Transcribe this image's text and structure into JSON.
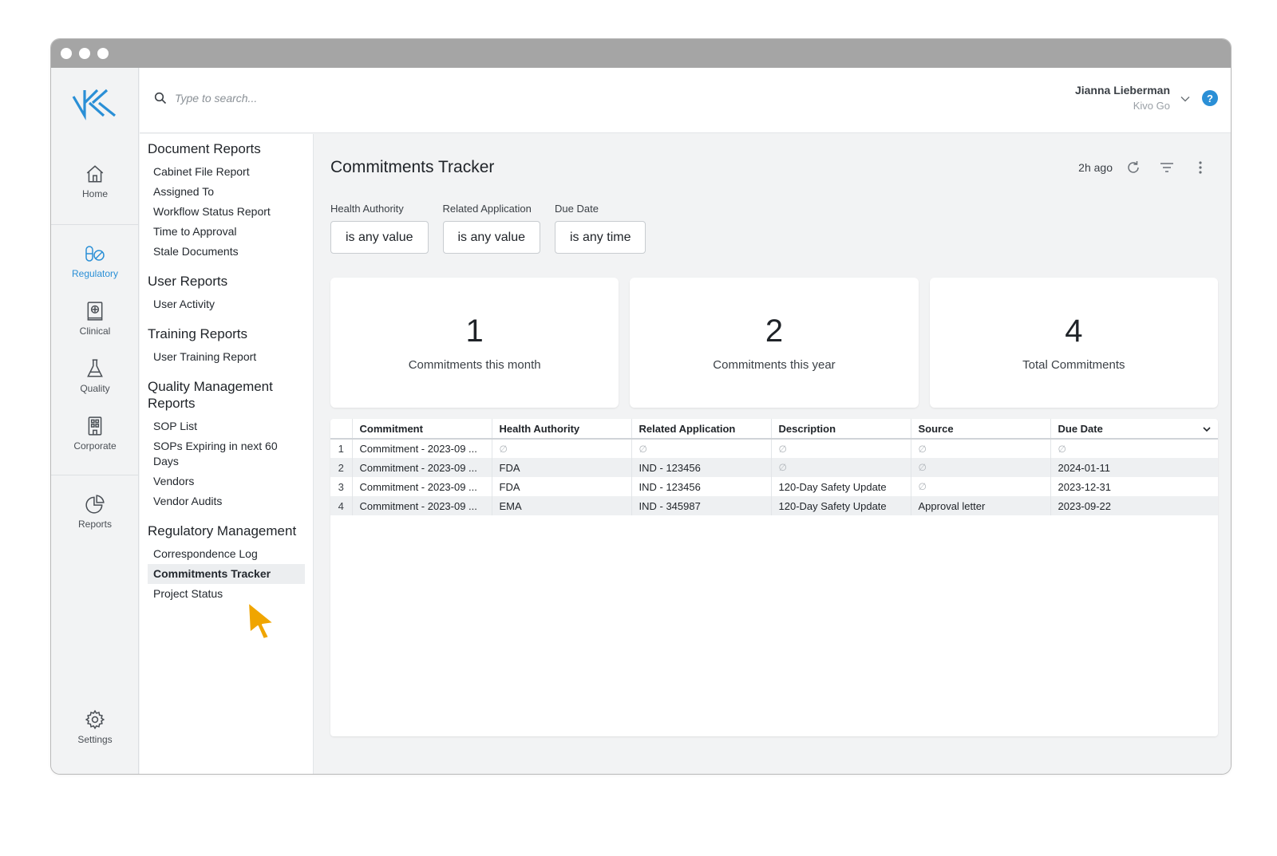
{
  "window": {
    "dot_count": 3
  },
  "search": {
    "placeholder": "Type to search..."
  },
  "user": {
    "name": "Jianna Lieberman",
    "org": "Kivo Go"
  },
  "help": {
    "label": "?"
  },
  "colors": {
    "brand": "#2a8fd6",
    "cursor": "#f0a500"
  },
  "rail": {
    "items": [
      {
        "label": "Home",
        "icon": "home-icon"
      },
      {
        "label": "Regulatory",
        "icon": "pill-icon",
        "active": true
      },
      {
        "label": "Clinical",
        "icon": "clinical-book-icon"
      },
      {
        "label": "Quality",
        "icon": "flask-icon"
      },
      {
        "label": "Corporate",
        "icon": "building-icon"
      },
      {
        "label": "Reports",
        "icon": "pie-chart-icon"
      },
      {
        "label": "Settings",
        "icon": "gear-icon"
      }
    ]
  },
  "reports_nav": {
    "groups": [
      {
        "heading": "Document Reports",
        "links": [
          "Cabinet File Report",
          "Assigned To",
          "Workflow Status Report",
          "Time to Approval",
          "Stale Documents"
        ]
      },
      {
        "heading": "User Reports",
        "links": [
          "User Activity"
        ]
      },
      {
        "heading": "Training Reports",
        "links": [
          "User Training Report"
        ]
      },
      {
        "heading": "Quality Management Reports",
        "links": [
          "SOP List",
          "SOPs Expiring in next 60 Days",
          "Vendors",
          "Vendor Audits"
        ]
      },
      {
        "heading": "Regulatory Management",
        "links": [
          "Correspondence Log",
          "Commitments Tracker",
          "Project Status"
        ],
        "active": "Commitments Tracker"
      }
    ]
  },
  "main": {
    "title": "Commitments Tracker",
    "updated": "2h ago",
    "filters": [
      {
        "label": "Health Authority",
        "value": "is any value"
      },
      {
        "label": "Related Application",
        "value": "is any value"
      },
      {
        "label": "Due Date",
        "value": "is any time"
      }
    ],
    "cards": [
      {
        "value": "1",
        "label": "Commitments this month"
      },
      {
        "value": "2",
        "label": "Commitments this year"
      },
      {
        "value": "4",
        "label": "Total Commitments"
      }
    ],
    "table": {
      "columns": [
        "Commitment",
        "Health Authority",
        "Related Application",
        "Description",
        "Source",
        "Due Date"
      ],
      "null_symbol": "∅",
      "rows": [
        {
          "n": "1",
          "cells": [
            "Commitment - 2023-09 ...",
            null,
            null,
            null,
            null,
            null
          ]
        },
        {
          "n": "2",
          "cells": [
            "Commitment - 2023-09 ...",
            "FDA",
            "IND - 123456",
            null,
            null,
            "2024-01-11"
          ]
        },
        {
          "n": "3",
          "cells": [
            "Commitment - 2023-09 ...",
            "FDA",
            "IND - 123456",
            "120-Day Safety Update",
            null,
            "2023-12-31"
          ]
        },
        {
          "n": "4",
          "cells": [
            "Commitment - 2023-09 ...",
            "EMA",
            "IND - 345987",
            "120-Day Safety Update",
            "Approval letter",
            "2023-09-22"
          ]
        }
      ]
    }
  }
}
